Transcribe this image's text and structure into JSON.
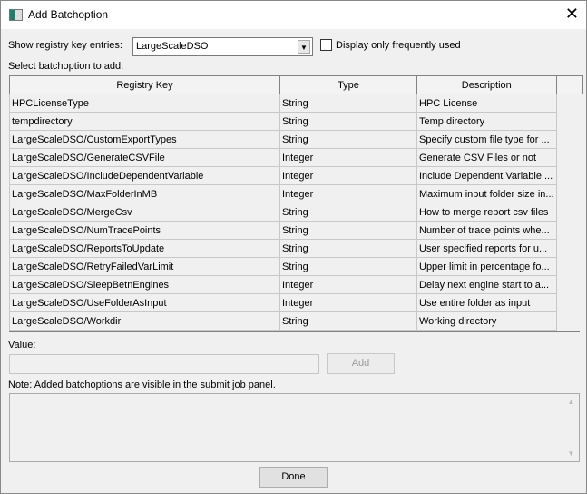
{
  "window": {
    "title": "Add Batchoption",
    "close": "✕"
  },
  "filter": {
    "label": "Show registry key entries:",
    "selected": "LargeScaleDSO",
    "checkbox_label": "Display only frequently used",
    "checked": false
  },
  "table": {
    "label": "Select batchoption to add:",
    "columns": [
      "Registry Key",
      "Type",
      "Description"
    ],
    "rows": [
      [
        "HPCLicenseType",
        "String",
        "HPC License"
      ],
      [
        "tempdirectory",
        "String",
        "Temp directory"
      ],
      [
        "LargeScaleDSO/CustomExportTypes",
        "String",
        "Specify custom file type for ..."
      ],
      [
        "LargeScaleDSO/GenerateCSVFile",
        "Integer",
        "Generate CSV Files or not"
      ],
      [
        "LargeScaleDSO/IncludeDependentVariable",
        "Integer",
        "Include Dependent Variable ..."
      ],
      [
        "LargeScaleDSO/MaxFolderInMB",
        "Integer",
        "Maximum input folder size in..."
      ],
      [
        "LargeScaleDSO/MergeCsv",
        "String",
        "How to merge report csv files"
      ],
      [
        "LargeScaleDSO/NumTracePoints",
        "String",
        "Number of trace points whe..."
      ],
      [
        "LargeScaleDSO/ReportsToUpdate",
        "String",
        "User specified reports for u..."
      ],
      [
        "LargeScaleDSO/RetryFailedVarLimit",
        "String",
        "Upper limit in percentage fo..."
      ],
      [
        "LargeScaleDSO/SleepBetnEngines",
        "Integer",
        "Delay next engine start to a..."
      ],
      [
        "LargeScaleDSO/UseFolderAsInput",
        "Integer",
        "Use entire folder as input"
      ],
      [
        "LargeScaleDSO/Workdir",
        "String",
        "Working directory"
      ]
    ]
  },
  "value": {
    "label": "Value:",
    "text": "",
    "add_label": "Add"
  },
  "note": "Note: Added batchoptions are visible in the submit job panel.",
  "done_label": "Done"
}
